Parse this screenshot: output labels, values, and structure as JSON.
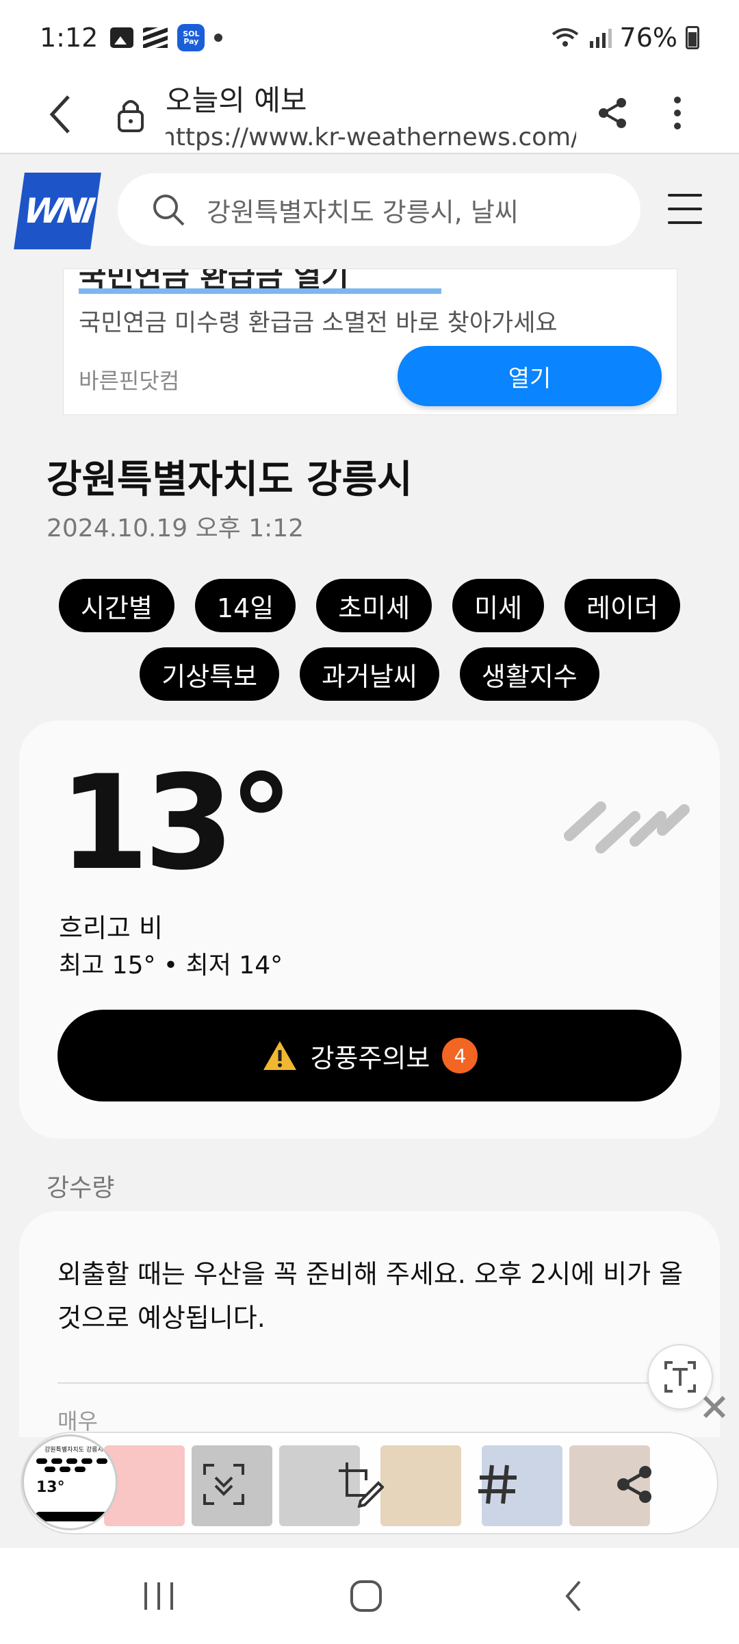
{
  "status": {
    "time": "1:12",
    "battery": "76%",
    "pay_label": "SOL Pay"
  },
  "browser": {
    "page_title": "오늘의 예보",
    "url": "https://www.kr-weathernews.com/r"
  },
  "site": {
    "logo": "WNI",
    "search_placeholder": "강원특별자치도 강릉시, 날씨"
  },
  "ad": {
    "title": "국민연금 환급금 열기",
    "description": "국민연금 미수령 환급금 소멸전 바로 찾아가세요",
    "brand": "바른핀닷컴",
    "button": "열기"
  },
  "location": {
    "name": "강원특별자치도 강릉시",
    "datetime": "2024.10.19 오후 1:12"
  },
  "tabs": [
    {
      "label": "시간별"
    },
    {
      "label": "14일"
    },
    {
      "label": "초미세"
    },
    {
      "label": "미세"
    },
    {
      "label": "레이더"
    },
    {
      "label": "기상특보"
    },
    {
      "label": "과거날씨"
    },
    {
      "label": "생활지수"
    }
  ],
  "current": {
    "temperature": "13°",
    "condition": "흐리고 비",
    "high_low": "최고 15° • 최저 14°",
    "weather_icon": "rain-icon",
    "alert_label": "강풍주의보",
    "alert_count": "4",
    "alert_color": "#f26522"
  },
  "rain": {
    "section_label": "강수량",
    "message": "외출할 때는 우산을 꼭 준비해 주세요. 오후 2시에 비가 올 것으로 예상됩니다.",
    "intensity_label": "매우"
  },
  "thumbnail": {
    "title": "강원특별자치도 강릉시",
    "temp": "13°"
  },
  "toolbar": {
    "icons": [
      "scroll-capture-icon",
      "crop-edit-icon",
      "hashtag-icon",
      "share-icon"
    ]
  },
  "colors": {
    "accent_blue": "#0a84ff",
    "logo_blue": "#1d55c8"
  }
}
